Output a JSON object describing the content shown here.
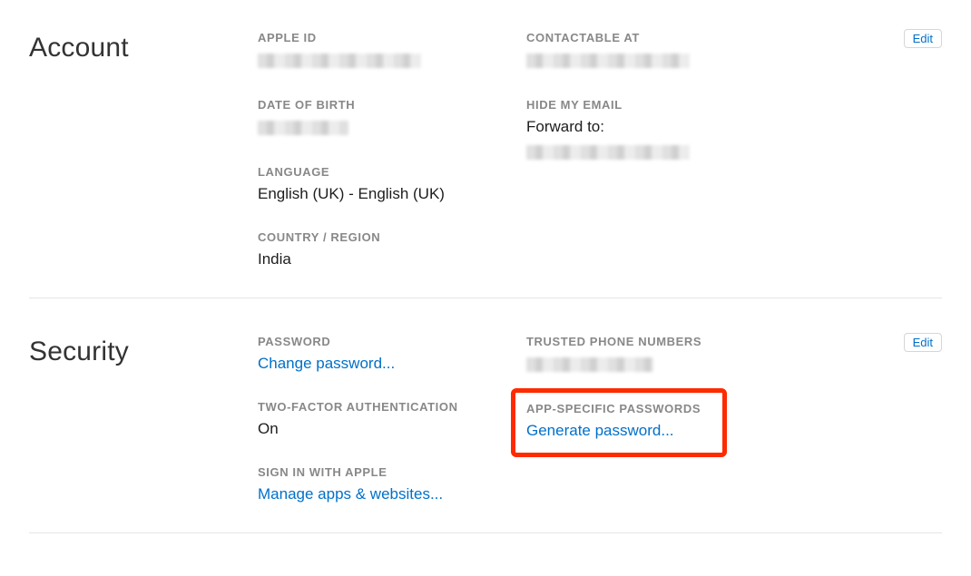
{
  "account": {
    "title": "Account",
    "edit": "Edit",
    "apple_id_label": "APPLE ID",
    "contactable_label": "CONTACTABLE AT",
    "dob_label": "DATE OF BIRTH",
    "hide_email_label": "HIDE MY EMAIL",
    "forward_to": "Forward to:",
    "language_label": "LANGUAGE",
    "language_value": "English (UK) - English (UK)",
    "country_label": "COUNTRY / REGION",
    "country_value": "India"
  },
  "security": {
    "title": "Security",
    "edit": "Edit",
    "password_label": "PASSWORD",
    "change_password": "Change password...",
    "trusted_label": "TRUSTED PHONE NUMBERS",
    "twofa_label": "TWO-FACTOR AUTHENTICATION",
    "twofa_value": "On",
    "app_specific_label": "APP-SPECIFIC PASSWORDS",
    "generate_password": "Generate password...",
    "signin_apple_label": "SIGN IN WITH APPLE",
    "manage_apps": "Manage apps & websites..."
  }
}
